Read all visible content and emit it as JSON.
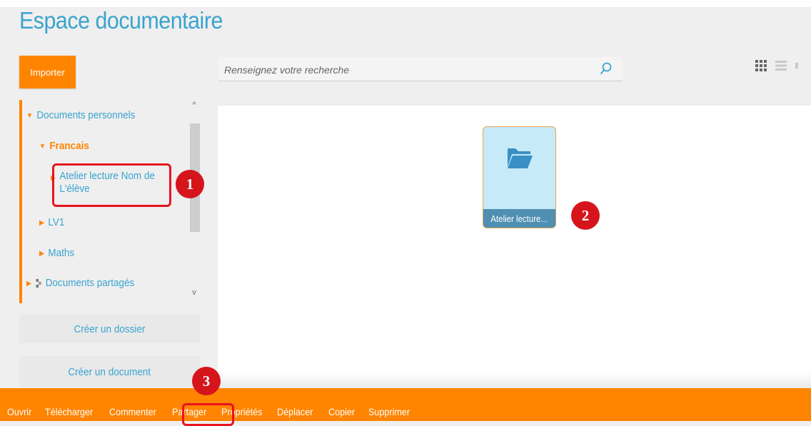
{
  "page": {
    "title": "Espace documentaire"
  },
  "toolbar": {
    "import_label": "Importer",
    "search": {
      "placeholder": "Renseignez votre recherche",
      "value": ""
    }
  },
  "tree": {
    "documents_personnels": "Documents personnels",
    "francais": "Francais",
    "atelier_line1": "Atelier lecture Nom de",
    "atelier_line2": "L'élève",
    "lv1": "LV1",
    "maths": "Maths",
    "documents_partages": "Documents partagés"
  },
  "sidebar_buttons": {
    "create_folder": "Créer un dossier",
    "create_document": "Créer un document"
  },
  "content": {
    "folder_label": "Atelier lecture..."
  },
  "actions": [
    "Ouvrir",
    "Télécharger",
    "Commenter",
    "Partager",
    "Propriétés",
    "Déplacer",
    "Copier",
    "Supprimer"
  ],
  "annotations": [
    "1",
    "2",
    "3"
  ],
  "colors": {
    "accent_orange": "#ff8400",
    "link_blue": "#3aa3cf",
    "annotation_red": "#e8131f",
    "folder_bg": "#c6eaf8",
    "folder_label_bg": "#4f8fb2"
  },
  "icons": {
    "search": "search-icon",
    "grid_view": "grid-view-icon",
    "list_view": "list-view-icon",
    "folder": "folder-open-icon",
    "shared": "shared-icon"
  }
}
